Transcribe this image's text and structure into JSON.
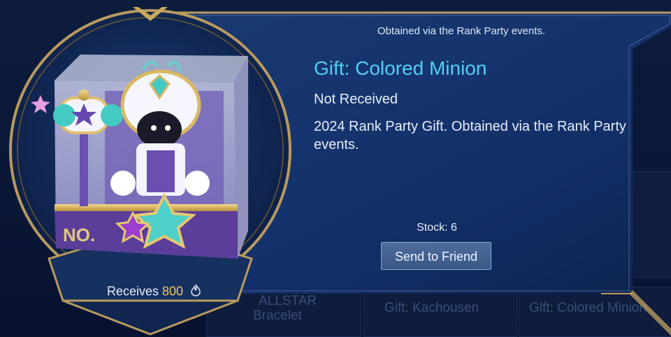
{
  "header": {
    "source_text": "Obtained via the Rank Party events."
  },
  "item": {
    "title": "Gift: Colored Minion",
    "status": "Not Received",
    "description": "2024 Rank Party Gift. Obtained via the Rank Party events.",
    "box_label": "NO."
  },
  "stock": {
    "label": "Stock: 6"
  },
  "actions": {
    "send_label": "Send to Friend"
  },
  "reward": {
    "label": "Receives",
    "points": "800",
    "icon": "fire-icon"
  },
  "background_items": [
    {
      "label": "ALLSTAR"
    },
    {
      "label": "Bracelet"
    },
    {
      "label": "Gift: Kachousen"
    },
    {
      "label": "Gift: Colored Minion"
    }
  ],
  "colors": {
    "title": "#4fd0f2",
    "points": "#f1c65a",
    "gold_frame": "#b89a5e",
    "panel": "#132c5c"
  }
}
